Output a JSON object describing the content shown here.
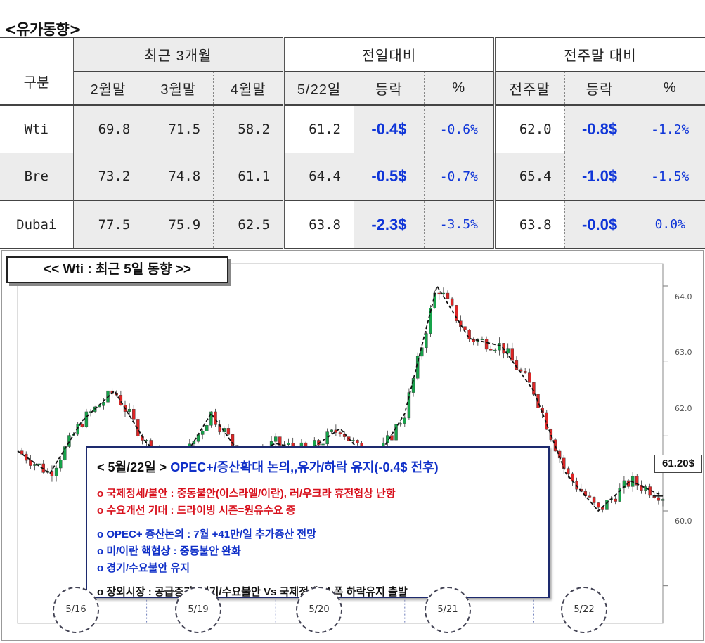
{
  "title": "<유가동향>",
  "table": {
    "groups": {
      "recent": "최근 3개월",
      "prev_day": "전일대비",
      "prev_week": "전주말 대비"
    },
    "headers": [
      "구분",
      "2월말",
      "3월말",
      "4월말",
      "5/22일",
      "등락",
      "%",
      "전주말",
      "등락",
      "%"
    ],
    "rows": [
      {
        "name": "Wti",
        "feb": "69.8",
        "mar": "71.5",
        "apr": "58.2",
        "today": "61.2",
        "chg": "-0.4$",
        "pct": "-0.6%",
        "lastwk": "62.0",
        "wchg": "-0.8$",
        "wpct": "-1.2%"
      },
      {
        "name": "Bre",
        "feb": "73.2",
        "mar": "74.8",
        "apr": "61.1",
        "today": "64.4",
        "chg": "-0.5$",
        "pct": "-0.7%",
        "lastwk": "65.4",
        "wchg": "-1.0$",
        "wpct": "-1.5%"
      },
      {
        "name": "Dubai",
        "feb": "77.5",
        "mar": "75.9",
        "apr": "62.5",
        "today": "63.8",
        "chg": "-2.3$",
        "pct": "-3.5%",
        "lastwk": "63.8",
        "wchg": "-0.0$",
        "wpct": "0.0%"
      }
    ]
  },
  "chart": {
    "title": "<< Wti : 최근 5일 동향 >>",
    "last_price": "61.20$",
    "info": {
      "heading_prefix": "< 5월/22일 >",
      "heading": "OPEC+/증산확대 논의,,유가/하락 유지(-0.4$ 전후)",
      "lines_red": [
        "o 국제정세/불안 : 중동불안(이스라엘/이란), 러/우크라 휴전협상 난항",
        "o 수요개선 기대 : 드라이빙 시즌=원유수요 증"
      ],
      "lines_blue": [
        "o OPEC+ 증산논의 : 7월 +41만/일 추가증산 전망",
        "o 미/이란 핵협상 : 중동불안 완화",
        "o 경기/수요불안 유지"
      ],
      "line_black": "o 장외시장 : 공급증가+경기/수요불안 Vs 국제정세,,소폭 하락유지 출발"
    }
  },
  "chart_data": {
    "type": "line",
    "title": "<< Wti : 최근 5일 동향 >>",
    "xlabel": "",
    "ylabel": "",
    "ylim": [
      59.5,
      64.3
    ],
    "yticks": [
      "60.0",
      "61.0",
      "62.0",
      "63.0",
      "64.0"
    ],
    "days": [
      "5/16",
      "5/19",
      "5/20",
      "5/21",
      "5/22"
    ],
    "x": [
      0,
      0.25,
      0.5,
      0.75,
      1,
      1.25,
      1.5,
      1.75,
      2,
      2.25,
      2.5,
      2.75,
      3,
      3.25,
      3.5,
      3.75,
      4,
      4.25,
      4.5,
      4.75,
      5
    ],
    "values": [
      61.8,
      61.5,
      62.2,
      62.6,
      61.9,
      61.6,
      62.3,
      61.7,
      61.9,
      61.8,
      62.1,
      61.6,
      62.3,
      64.0,
      63.3,
      63.2,
      62.6,
      61.5,
      61.0,
      61.4,
      61.2
    ],
    "last_label": "61.20$",
    "colors": {
      "up": "#16a34a",
      "down": "#dc2626",
      "ma": "#111111"
    }
  }
}
